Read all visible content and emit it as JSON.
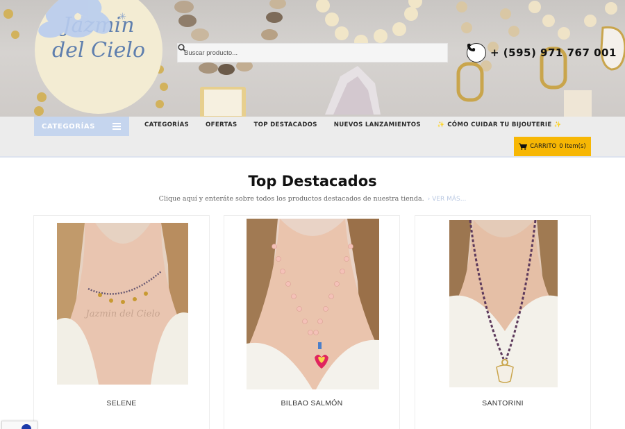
{
  "brand": {
    "line1": "Jazmin",
    "line2": "del Cielo",
    "colors": {
      "logo_bg": "#f3ecd3",
      "logo_text": "#5f7fae"
    }
  },
  "search": {
    "placeholder": "Buscar producto..."
  },
  "contact": {
    "phone": "+ (595) 971 767 001"
  },
  "categories_menu": {
    "label": "CATEGORÍAS"
  },
  "nav": {
    "items": [
      {
        "label": "CATEGORÍAS"
      },
      {
        "label": "OFERTAS"
      },
      {
        "label": "TOP DESTACADOS"
      },
      {
        "label": "NUEVOS LANZAMIENTOS"
      }
    ],
    "care": {
      "label": "CÓMO CUIDAR TU BIJOUTERIE",
      "sparkle": "✨"
    }
  },
  "cart": {
    "label": "CARRITO",
    "count_text": "0 Item(s)"
  },
  "section": {
    "title": "Top Destacados",
    "subtitle": "Clique aquí y enteráte sobre todos los productos destacados de nuestra tienda.",
    "more_link": "› VER MÁS..."
  },
  "products": [
    {
      "name": "SELENE"
    },
    {
      "name": "BILBAO SALMÓN"
    },
    {
      "name": "SANTORINI"
    }
  ],
  "colors": {
    "accent": "#f7b704",
    "category_box": "#c5d5ee",
    "nav_bg": "#ececec"
  }
}
